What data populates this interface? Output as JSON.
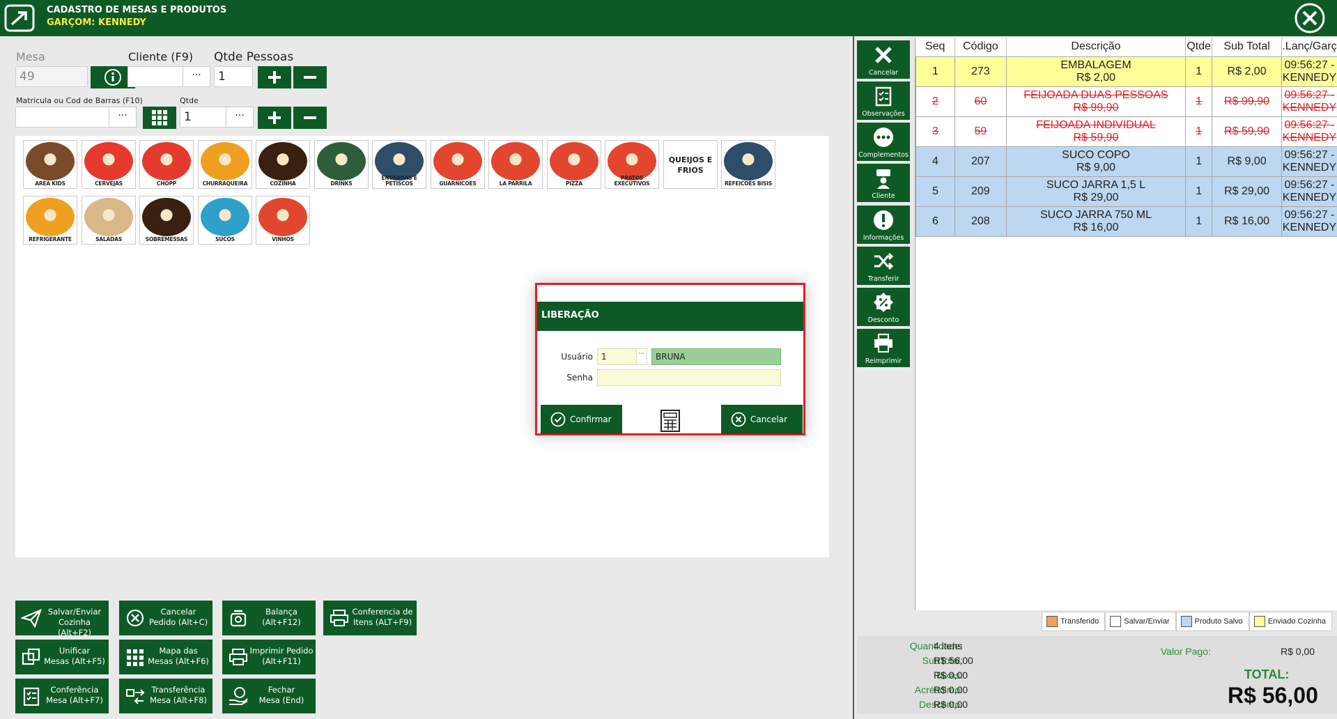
{
  "header": {
    "title": "CADASTRO DE MESAS E PRODUTOS",
    "subtitle": "GARÇOM: KENNEDY"
  },
  "form": {
    "mesa_label": "Mesa",
    "mesa_value": "49",
    "cliente_label": "Cliente (F9)",
    "cliente_value": "",
    "pessoas_label": "Qtde Pessoas",
    "pessoas_value": "1",
    "barcode_label": "Matricula ou Cod de Barras (F10)",
    "barcode_value": "",
    "qtde_label": "Qtde",
    "qtde_value": "1",
    "ellipsis": "···"
  },
  "categories": [
    {
      "name": "AREA KIDS",
      "color": "#7a4b2a"
    },
    {
      "name": "CERVEJAS",
      "color": "#e63a2e"
    },
    {
      "name": "CHOPP",
      "color": "#e63a2e"
    },
    {
      "name": "CHURRAQUEIRA",
      "color": "#f0a020"
    },
    {
      "name": "COZINHA",
      "color": "#3a2010"
    },
    {
      "name": "DRINKS",
      "color": "#2e5d3a"
    },
    {
      "name": "ENTRADAS E PETISCOS",
      "color": "#2d4d68"
    },
    {
      "name": "GUARNICOES",
      "color": "#e2462f"
    },
    {
      "name": "LA PARRILA",
      "color": "#e2462f"
    },
    {
      "name": "PIZZA",
      "color": "#e2462f"
    },
    {
      "name": "PRATOS EXECUTIVOS",
      "color": "#e2462f"
    },
    {
      "name": "QUEIJOS E FRIOS",
      "color": "#ffffff"
    },
    {
      "name": "REFEICOES BISIS",
      "color": "#2d4d68"
    },
    {
      "name": "REFRIGERANTE",
      "color": "#f0a020"
    },
    {
      "name": "SALADAS",
      "color": "#d9b887"
    },
    {
      "name": "SOBREMESSAS",
      "color": "#3a2010"
    },
    {
      "name": "SUCOS",
      "color": "#2fa0c9"
    },
    {
      "name": "VINHOS",
      "color": "#e2462f"
    }
  ],
  "actions": [
    {
      "line1": "Salvar/Enviar",
      "line2": "Cozinha (Alt+F2)"
    },
    {
      "line1": "Cancelar",
      "line2": "Pedido (Alt+C)"
    },
    {
      "line1": "Balança",
      "line2": "(Alt+F12)"
    },
    {
      "line1": "Conferencia de",
      "line2": "Itens (ALT+F9)"
    },
    {
      "line1": "Unificar",
      "line2": "Mesas (Alt+F5)"
    },
    {
      "line1": "Mapa das",
      "line2": "Mesas (Alt+F6)"
    },
    {
      "line1": "Imprimir Pedido",
      "line2": "(Alt+F11)"
    },
    {
      "line1": "Conferência",
      "line2": "Mesa (Alt+F7)"
    },
    {
      "line1": "Transferência",
      "line2": "Mesa (Alt+F8)"
    },
    {
      "line1": "Fechar",
      "line2": "Mesa (End)"
    }
  ],
  "dialog": {
    "title": "LIBERAÇÃO",
    "usuario_label": "Usuário",
    "usuario_value": "1",
    "usuario_name": "BRUNA",
    "senha_label": "Senha",
    "senha_value": "",
    "confirm_label": "Confirmar",
    "cancel_label": "Cancelar"
  },
  "side_tools": [
    {
      "label": "Cancelar"
    },
    {
      "label": "Observações"
    },
    {
      "label": "Complementos"
    },
    {
      "label": "Cliente"
    },
    {
      "label": "Informações"
    },
    {
      "label": "Transferir"
    },
    {
      "label": "Desconto"
    },
    {
      "label": "Reimprimir"
    }
  ],
  "table": {
    "headers": [
      "Seq",
      "Código",
      "Descrição",
      "Qtde",
      "Sub Total",
      ".Lanç/Garç"
    ],
    "rows": [
      {
        "seq": "1",
        "codigo": "273",
        "desc": "EMBALAGEM",
        "price": "R$ 2,00",
        "qtde": "1",
        "subtotal": "R$ 2,00",
        "time": "09:56:27 -",
        "waiter": "KENNEDY",
        "status": "sent"
      },
      {
        "seq": "2",
        "codigo": "60",
        "desc": "FEIJOADA DUAS PESSOAS",
        "price": "R$ 99,90",
        "qtde": "1",
        "subtotal": "R$ 99,90",
        "time": "09:56:27 -",
        "waiter": "KENNEDY",
        "status": "cancelled"
      },
      {
        "seq": "3",
        "codigo": "59",
        "desc": "FEIJOADA INDIVIDUAL",
        "price": "R$ 59,90",
        "qtde": "1",
        "subtotal": "R$ 59,90",
        "time": "09:56:27 -",
        "waiter": "KENNEDY",
        "status": "cancelled"
      },
      {
        "seq": "4",
        "codigo": "207",
        "desc": "SUCO COPO",
        "price": "R$ 9,00",
        "qtde": "1",
        "subtotal": "R$ 9,00",
        "time": "09:56:27 -",
        "waiter": "KENNEDY",
        "status": "saved"
      },
      {
        "seq": "5",
        "codigo": "209",
        "desc": "SUCO JARRA 1,5 L",
        "price": "R$ 29,00",
        "qtde": "1",
        "subtotal": "R$ 29,00",
        "time": "09:56:27 -",
        "waiter": "KENNEDY",
        "status": "saved"
      },
      {
        "seq": "6",
        "codigo": "208",
        "desc": "SUCO JARRA 750 ML",
        "price": "R$ 16,00",
        "qtde": "1",
        "subtotal": "R$ 16,00",
        "time": "09:56:27 -",
        "waiter": "KENNEDY",
        "status": "saved"
      }
    ]
  },
  "legend": [
    {
      "label": "Transferido",
      "color": "#f0a060"
    },
    {
      "label": "Salvar/Enviar",
      "color": "#ffffff"
    },
    {
      "label": "Produto Salvo",
      "color": "#bcd7ef"
    },
    {
      "label": "Enviado Cozinha",
      "color": "#ffff99"
    }
  ],
  "totals": {
    "quantidade_label": "Quantidade:",
    "quantidade": "4 itens",
    "subtotal_label": "SubTotal:",
    "subtotal": "R$ 56,00",
    "taxas_label": "Taxas:",
    "taxas": "R$ 0,00",
    "acrescimo_label": "Acréscimo:",
    "acrescimo": "R$ 0,00",
    "desconto_label": "Desconto:",
    "desconto": "R$ 0,00",
    "valor_pago_label": "Valor Pago:",
    "valor_pago": "R$ 0,00",
    "total_label": "TOTAL:",
    "total": "R$ 56,00"
  },
  "colors": {
    "brand": "#0e5a26",
    "accent": "#f6e94a",
    "alert": "#e21f26"
  }
}
